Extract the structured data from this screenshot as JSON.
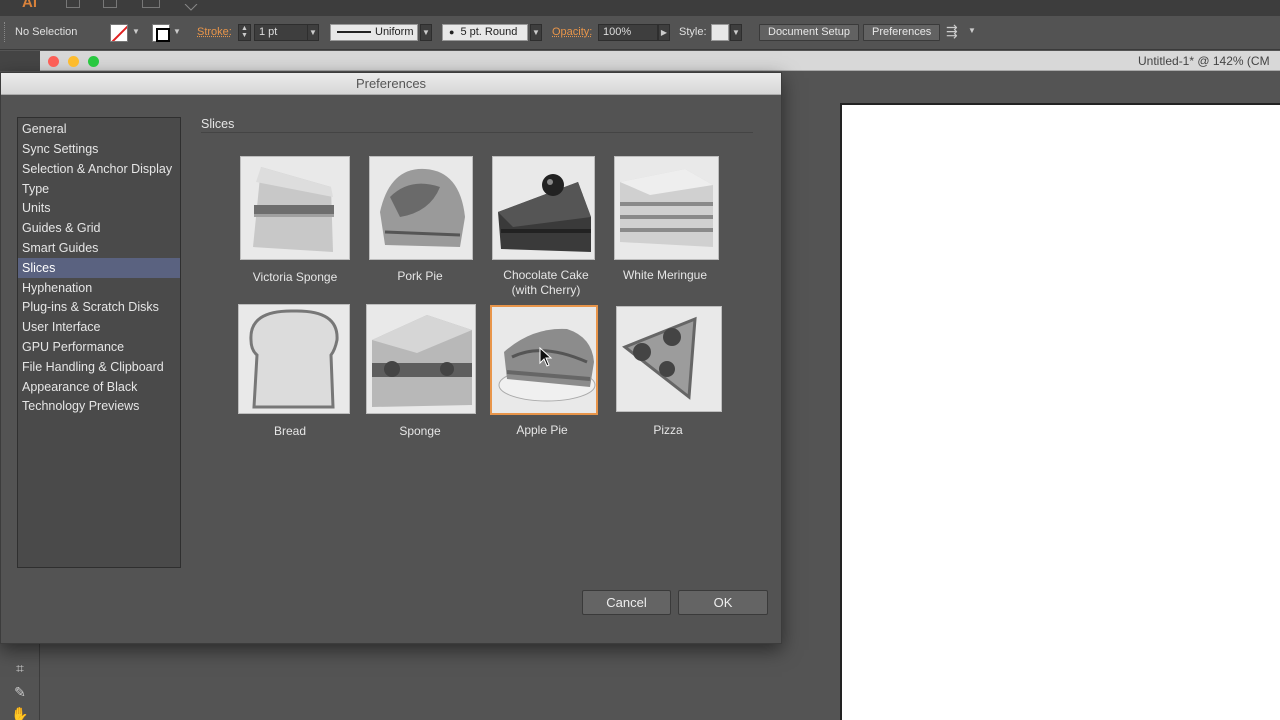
{
  "app": {
    "logo": "Ai",
    "icons": [
      "bridge-icon",
      "stock-icon",
      "workspace-icon",
      "feather-icon"
    ]
  },
  "control_bar": {
    "selection_label": "No Selection",
    "stroke_label": "Stroke:",
    "stroke_weight": "1 pt",
    "profile": "Uniform",
    "brush": "5 pt. Round",
    "opacity_label": "Opacity:",
    "opacity": "100%",
    "style_label": "Style:",
    "document_setup": "Document Setup",
    "preferences": "Preferences",
    "accent_color": "#e8954a"
  },
  "document": {
    "title": "Untitled-1* @ 142% (CM"
  },
  "dialog": {
    "title": "Preferences",
    "section_title": "Slices",
    "sidebar": [
      {
        "label": "General"
      },
      {
        "label": "Sync Settings"
      },
      {
        "label": "Selection & Anchor Display"
      },
      {
        "label": "Type"
      },
      {
        "label": "Units"
      },
      {
        "label": "Guides & Grid"
      },
      {
        "label": "Smart Guides"
      },
      {
        "label": "Slices",
        "selected": true
      },
      {
        "label": "Hyphenation"
      },
      {
        "label": "Plug-ins & Scratch Disks"
      },
      {
        "label": "User Interface"
      },
      {
        "label": "GPU Performance"
      },
      {
        "label": "File Handling & Clipboard"
      },
      {
        "label": "Appearance of Black"
      },
      {
        "label": "Technology Previews"
      }
    ],
    "slices": [
      {
        "label": "Victoria Sponge",
        "icon": "victoria-sponge-image"
      },
      {
        "label": "Pork Pie",
        "icon": "pork-pie-image"
      },
      {
        "label": "Chocolate Cake\n(with Cherry)",
        "icon": "chocolate-cake-image"
      },
      {
        "label": "White Meringue",
        "icon": "white-meringue-image"
      },
      {
        "label": "Bread",
        "icon": "bread-image"
      },
      {
        "label": "Sponge",
        "icon": "sponge-image"
      },
      {
        "label": "Apple Pie",
        "icon": "apple-pie-image",
        "selected": true
      },
      {
        "label": "Pizza",
        "icon": "pizza-image"
      }
    ],
    "cancel": "Cancel",
    "ok": "OK"
  }
}
